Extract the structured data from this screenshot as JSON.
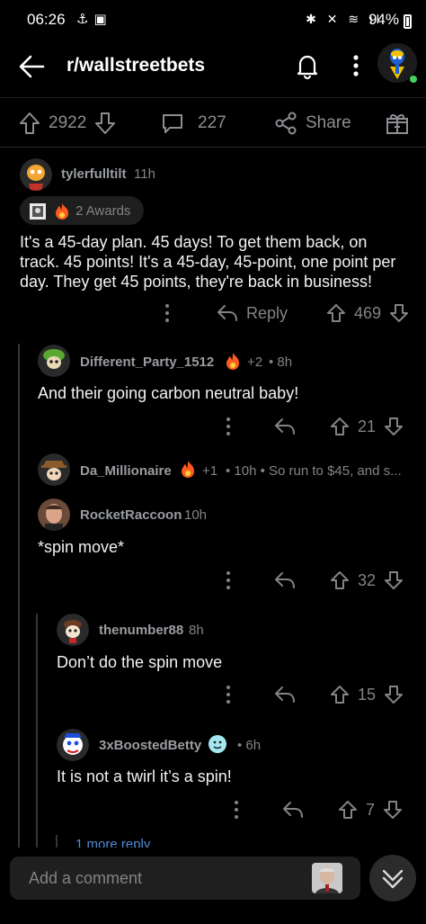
{
  "status": {
    "time": "06:26",
    "battery": "94%"
  },
  "header": {
    "title": "r/wallstreetbets"
  },
  "post_actions": {
    "upvotes": "2922",
    "comments": "227",
    "share": "Share"
  },
  "comments": [
    {
      "user": "tylerfulltilt",
      "age": "11h",
      "awards": "2 Awards",
      "text": "It's a 45-day plan. 45 days! To get them back, on track. 45 points! It's a 45-day, 45-point, one point per day. They get 45 points, they're back in business!",
      "reply": "Reply",
      "score": "469"
    },
    {
      "user": "Different_Party_1512",
      "award_count": "+2",
      "age": "• 8h",
      "text": "And their going carbon neutral baby!",
      "score": "21"
    },
    {
      "user": "Da_Millionaire",
      "award_count": "+1",
      "age": "• 10h • So run to $45, and s...",
      "score": ""
    },
    {
      "user": "RocketRaccoon",
      "age": "10h",
      "text": "*spin move*",
      "score": "32"
    },
    {
      "user": "thenumber88",
      "age": "8h",
      "text": "Don’t do the spin move",
      "score": "15"
    },
    {
      "user": "3xBoostedBetty",
      "age": "• 6h",
      "text": "It is not a twirl it’s a spin!",
      "score": "7"
    }
  ],
  "more_reply": "1 more reply",
  "composer": {
    "placeholder": "Add a comment"
  }
}
